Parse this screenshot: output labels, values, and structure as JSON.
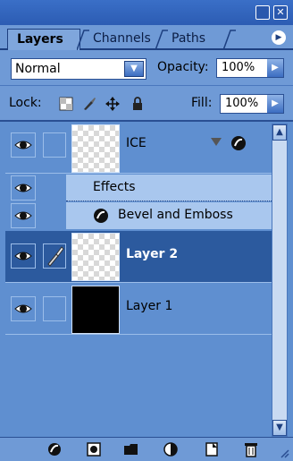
{
  "tabs": [
    {
      "label": "Layers",
      "active": true
    },
    {
      "label": "Channels",
      "active": false
    },
    {
      "label": "Paths",
      "active": false
    }
  ],
  "blend": {
    "mode": "Normal",
    "opacity_label": "Opacity:",
    "opacity_value": "100%"
  },
  "lock": {
    "label": "Lock:",
    "fill_label": "Fill:",
    "fill_value": "100%"
  },
  "layers": [
    {
      "name": "ICE",
      "visible": true,
      "selected": false,
      "thumbnail": "transparent",
      "effects": [
        "Effects",
        "Bevel and Emboss"
      ]
    },
    {
      "name": "Layer 2",
      "visible": true,
      "selected": true,
      "thumbnail": "transparent"
    },
    {
      "name": "Layer 1",
      "visible": true,
      "selected": false,
      "thumbnail": "black"
    }
  ],
  "colors": {
    "panel": "#5f8fd0",
    "selected_row": "#2c5a9e",
    "effects_bg": "#a9c7ee",
    "titlebar": "#3a6fc7"
  },
  "bottom_icons": [
    "layer-style-icon",
    "mask-icon",
    "new-group-icon",
    "adjustment-layer-icon",
    "new-layer-icon",
    "trash-icon"
  ]
}
